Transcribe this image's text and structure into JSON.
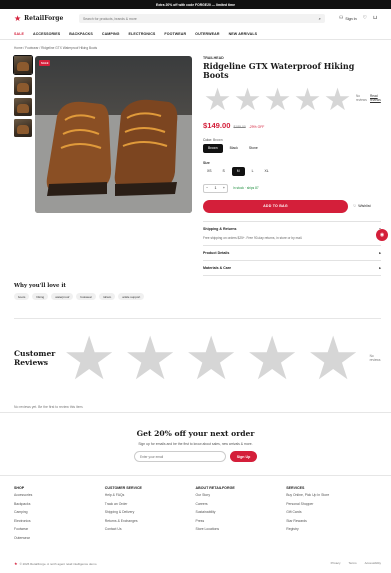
{
  "promo": "Extra 20% off with code FORGE20 — limited time",
  "brand": {
    "name": "RetailForge",
    "logo_icon": "star-icon"
  },
  "search": {
    "placeholder": "Search for products, brands & more"
  },
  "header": {
    "sign_in": "Sign In"
  },
  "nav": [
    "SALE",
    "ACCESSORIES",
    "BACKPACKS",
    "CAMPING",
    "ELECTRONICS",
    "FOOTWEAR",
    "OUTERWEAR",
    "NEW ARRIVALS"
  ],
  "breadcrumb": "Home / Footwear / Ridgeline GTX Waterproof Hiking Boots",
  "gallery": {
    "badge": "SALE"
  },
  "product": {
    "brand": "TRAILHEAD",
    "title": "Ridgeline GTX Waterproof Hiking Boots",
    "stars": [
      "★",
      "★",
      "★",
      "★",
      "★"
    ],
    "no_reviews": "No reviews",
    "read_reviews": "Read reviews",
    "price": "$149.00",
    "old_price": "$189.00",
    "discount": "-29% OFF",
    "color_label": "Color:",
    "color_value": "Brown",
    "colors": [
      "Brown",
      "Black",
      "Stone"
    ],
    "selected_color": "Brown",
    "size_label": "Size",
    "sizes": [
      "XS",
      "S",
      "M",
      "L",
      "XL"
    ],
    "selected_size": "M",
    "quantity": "1",
    "stock": "In stock · ships 87",
    "add_to_bag": "ADD TO BAG",
    "wishlist": "Wishlist"
  },
  "accordion": [
    {
      "title": "Shipping & Returns",
      "icon": "−",
      "body": "Free shipping on orders $25+. Free 90-day returns, in store or by mail."
    },
    {
      "title": "Product Details",
      "icon": "▸",
      "body": ""
    },
    {
      "title": "Materials & Care",
      "icon": "▸",
      "body": ""
    }
  ],
  "why": {
    "title": "Why you'll love it",
    "tags": [
      "boots",
      "hiking",
      "waterproof",
      "footwear",
      "rdcam",
      "ankle support"
    ]
  },
  "reviews": {
    "title": "Customer Reviews",
    "stars": [
      "★",
      "★",
      "★",
      "★",
      "★"
    ],
    "none": "No reviews",
    "empty": "No reviews yet. Be the first to review this item."
  },
  "newsletter": {
    "title": "Get 20% off your next order",
    "subtitle": "Sign up for emails and be the first to know about sales, new arrivals & more.",
    "placeholder": "Enter your email",
    "button": "Sign Up"
  },
  "footer": [
    {
      "title": "SHOP",
      "links": [
        "Accessories",
        "Backpacks",
        "Camping",
        "Electronics",
        "Footwear",
        "Outerwear"
      ]
    },
    {
      "title": "CUSTOMER SERVICE",
      "links": [
        "Help & FAQs",
        "Track an Order",
        "Shipping & Delivery",
        "Returns & Exchanges",
        "Contact Us"
      ]
    },
    {
      "title": "ABOUT RETAILFORGE",
      "links": [
        "Our Story",
        "Careers",
        "Sustainability",
        "Press",
        "Store Locations"
      ]
    },
    {
      "title": "SERVICES",
      "links": [
        "Buy Online, Pick Up In Store",
        "Personal Shopper",
        "Gift Cards",
        "Star Rewards",
        "Registry"
      ]
    }
  ],
  "bottom": {
    "copyright": "© 2026 RetailForge. A north agent retail intelligence demo",
    "links": [
      "Privacy",
      "Terms",
      "Accessibility"
    ]
  }
}
